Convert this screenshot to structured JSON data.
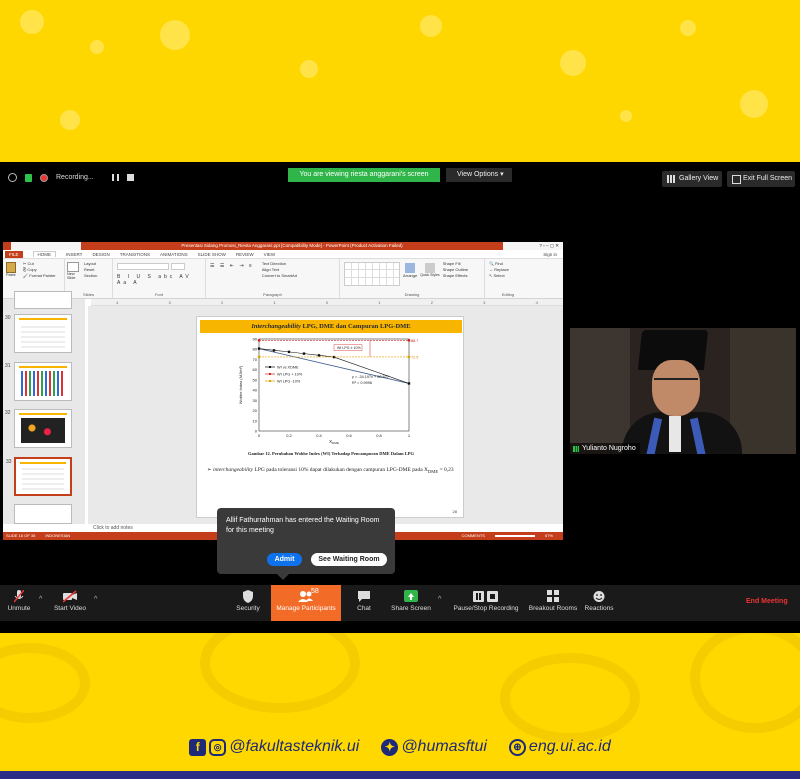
{
  "topbar": {
    "recording_label": "Recording...",
    "viewing_banner": "You are viewing riesta anggarani's screen",
    "view_options": "View Options",
    "gallery_view": "Gallery View",
    "exit_fullscreen": "Exit Full Screen"
  },
  "ppt": {
    "window_title": "Presentasi Sidang Promosi_Riesta Anggarani.ppt [Compatibility Mode] - PowerPoint (Product Activation Failed)",
    "sign_in": "Sign in",
    "tabs": [
      "FILE",
      "HOME",
      "INSERT",
      "DESIGN",
      "TRANSITIONS",
      "ANIMATIONS",
      "SLIDE SHOW",
      "REVIEW",
      "VIEW"
    ],
    "ribbon": {
      "clipboard": {
        "name": "Clipboard",
        "cut": "Cut",
        "copy": "Copy",
        "paste": "Paste",
        "format_painter": "Format Painter"
      },
      "slides": {
        "name": "Slides",
        "new_slide": "New Slide",
        "layout": "Layout",
        "reset": "Reset",
        "section": "Section"
      },
      "font": {
        "name": "Font"
      },
      "paragraph": {
        "name": "Paragraph",
        "text_direction": "Text Direction",
        "align_text": "Align Text",
        "convert": "Convert to SmartArt"
      },
      "drawing": {
        "name": "Drawing",
        "arrange": "Arrange",
        "quick_styles": "Quick Styles",
        "shape_fill": "Shape Fill",
        "shape_outline": "Shape Outline",
        "shape_effects": "Shape Effects"
      },
      "editing": {
        "name": "Editing",
        "find": "Find",
        "replace": "Replace",
        "select": "Select"
      }
    },
    "ruler": [
      "4",
      "3",
      "2",
      "1",
      "0",
      "1",
      "2",
      "3",
      "4"
    ],
    "thumbnails": [
      "30",
      "31",
      "32",
      "33"
    ],
    "slide": {
      "title_italic": "Interchangeability",
      "title_rest": " LPG, DME dan Campuran LPG-DME",
      "caption": "Gambar 12. Perubahan Wobbe Index (WI) Terhadap Pencampuran DME Dalam LPG",
      "bullet_italic": "interchangeability",
      "bullet_rest": " LPG pada toleransi 10% dapat dilakukan dengan campuran LPG-DME pada X",
      "bullet_sub": "DME",
      "bullet_end": " = 0,23",
      "page": "28"
    },
    "notes_placeholder": "Click to add notes",
    "status_slide": "SLIDE 16 OF 35",
    "status_lang": "INDONESIAN",
    "status_comments": "COMMENTS",
    "zoom": "67%"
  },
  "chart_data": {
    "type": "line",
    "ylabel": "Wobbe Index (MJ/m³)",
    "xlabel": "X",
    "xlabel_sub": "DME",
    "xlim": [
      0,
      1
    ],
    "ylim": [
      0,
      90
    ],
    "xticks": [
      "0",
      "0.2",
      "0.4",
      "0.6",
      "0.8",
      "1"
    ],
    "yticks": [
      "0",
      "10",
      "20",
      "30",
      "40",
      "50",
      "60",
      "70",
      "80",
      "90"
    ],
    "series": [
      {
        "name": "WI vs XDME",
        "color": "#111111",
        "x": [
          0,
          0.1,
          0.2,
          0.3,
          0.4,
          0.5,
          1
        ],
        "y": [
          80.6,
          78.9,
          77.4,
          75.7,
          74.0,
          72.3,
          46.5
        ]
      },
      {
        "name": "WI LPG + 10%",
        "color": "#cc2222",
        "x": [
          0,
          1
        ],
        "y": [
          88.7,
          88.7
        ]
      },
      {
        "name": "WI LPG -10%",
        "color": "#e0a000",
        "x": [
          0,
          1
        ],
        "y": [
          72.5,
          72.5
        ]
      }
    ],
    "fit_color": "#3a5a8c",
    "fit_x": [
      0,
      1
    ],
    "fit_y": [
      80.6,
      46.5
    ],
    "annotations": {
      "equation": "y = -34.197x + 80.627",
      "r2": "R² = 0.9996",
      "tolerance": "WI LPG ± 10%",
      "upper_value": "88.7",
      "lower_value": "72.5"
    }
  },
  "camera": {
    "participant_name": "Yulianto Nugroho"
  },
  "notification": {
    "message": "Allif Fathurrahman has entered the Waiting Room for this meeting",
    "admit": "Admit",
    "see_waiting_room": "See Waiting Room"
  },
  "toolbar": {
    "unmute": "Unmute",
    "start_video": "Start Video",
    "security": "Security",
    "manage_participants": "Manage Participants",
    "participant_count": "58",
    "chat": "Chat",
    "share_screen": "Share Screen",
    "pause_stop_recording": "Pause/Stop Recording",
    "breakout_rooms": "Breakout Rooms",
    "reactions": "Reactions",
    "end_meeting": "End Meeting"
  },
  "footer": {
    "facebook_instagram": "@fakultasteknik.ui",
    "twitter": "@humasftui",
    "website": "eng.ui.ac.id"
  }
}
